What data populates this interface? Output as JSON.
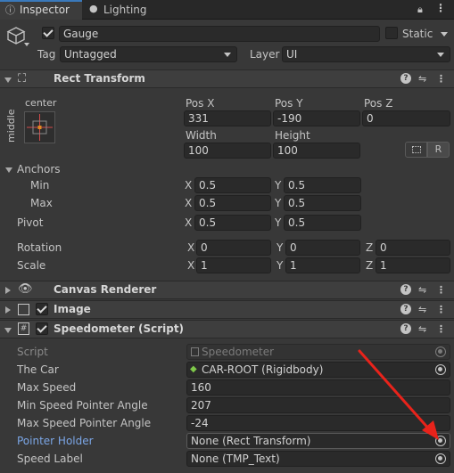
{
  "tabs": [
    {
      "label": "Inspector",
      "icon": "info-icon"
    },
    {
      "label": "Lighting",
      "icon": "light-bulb-icon"
    }
  ],
  "object": {
    "name": "Gauge",
    "static_label": "Static",
    "tag_label": "Tag",
    "tag_value": "Untagged",
    "layer_label": "Layer",
    "layer_value": "UI"
  },
  "rect_transform": {
    "title": "Rect Transform",
    "anchor_h": "center",
    "anchor_v": "middle",
    "pos_x_label": "Pos X",
    "pos_x": "331",
    "pos_y_label": "Pos Y",
    "pos_y": "-190",
    "pos_z_label": "Pos Z",
    "pos_z": "0",
    "width_label": "Width",
    "width": "100",
    "height_label": "Height",
    "height": "100",
    "raw_button": "R",
    "anchors_label": "Anchors",
    "min_label": "Min",
    "min_x": "0.5",
    "min_y": "0.5",
    "max_label": "Max",
    "max_x": "0.5",
    "max_y": "0.5",
    "pivot_label": "Pivot",
    "pivot_x": "0.5",
    "pivot_y": "0.5",
    "rotation_label": "Rotation",
    "rot_x": "0",
    "rot_y": "0",
    "rot_z": "0",
    "scale_label": "Scale",
    "scale_x": "1",
    "scale_y": "1",
    "scale_z": "1",
    "axis_x": "X",
    "axis_y": "Y",
    "axis_z": "Z"
  },
  "components": {
    "canvas_renderer": "Canvas Renderer",
    "image": "Image",
    "speedometer": "Speedometer (Script)"
  },
  "script": {
    "script_label": "Script",
    "script_value": "Speedometer",
    "car_label": "The Car",
    "car_value": "CAR-ROOT (Rigidbody)",
    "max_speed_label": "Max Speed",
    "max_speed": "160",
    "min_angle_label": "Min Speed Pointer Angle",
    "min_angle": "207",
    "max_angle_label": "Max Speed Pointer Angle",
    "max_angle": "-24",
    "pointer_label": "Pointer Holder",
    "pointer_value": "None (Rect Transform)",
    "speed_label_label": "Speed Label",
    "speed_label_value": "None (TMP_Text)"
  },
  "colors": {
    "accent": "#3a79bb",
    "annotation_arrow": "#e8231b",
    "highlight_label": "#7ba6e6"
  }
}
